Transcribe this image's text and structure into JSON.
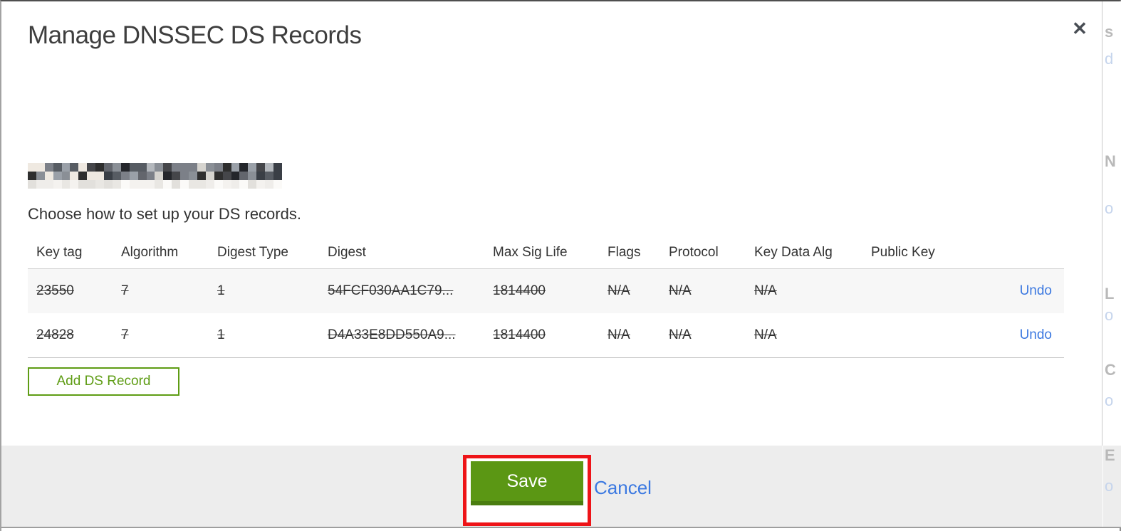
{
  "window": {
    "title": "Manage DNSSEC DS Records",
    "close_icon": "✕"
  },
  "modal": {
    "domain_redacted": true,
    "subtitle": "Choose how to set up your DS records.",
    "add_ds_record_button": "Add DS Record",
    "save_button": "Save",
    "cancel_link": "Cancel"
  },
  "table": {
    "columns": [
      "Key tag",
      "Algorithm",
      "Digest Type",
      "Digest",
      "Max Sig Life",
      "Flags",
      "Protocol",
      "Key Data Alg",
      "Public Key"
    ],
    "rows": [
      {
        "key_tag": "23550",
        "algorithm": "7",
        "digest_type": "1",
        "digest": "54FCF030AA1C79...",
        "max_sig_life": "1814400",
        "flags": "N/A",
        "protocol": "N/A",
        "key_data_alg": "N/A",
        "public_key": "",
        "action": "Undo",
        "state": "marked-for-deletion"
      },
      {
        "key_tag": "24828",
        "algorithm": "7",
        "digest_type": "1",
        "digest": "D4A33E8DD550A9...",
        "max_sig_life": "1814400",
        "flags": "N/A",
        "protocol": "N/A",
        "key_data_alg": "N/A",
        "public_key": "",
        "action": "Undo",
        "state": "marked-for-deletion"
      }
    ]
  },
  "annotation": {
    "highlighted_element": "save-button",
    "highlight_color": "#ee1418"
  },
  "colors": {
    "accent_green": "#5b9714",
    "accent_green_dark": "#4a7d10",
    "outline_green": "#5e9c14",
    "link_blue": "#3b78e0",
    "footer_gray": "#ededed",
    "row_stripe": "#f7f7f7",
    "title_text": "#3e3e3e"
  },
  "background_page_strip": {
    "fragments": [
      "s",
      "d",
      "N",
      "o",
      "L",
      "o",
      "C",
      "o",
      "E",
      "o"
    ]
  }
}
